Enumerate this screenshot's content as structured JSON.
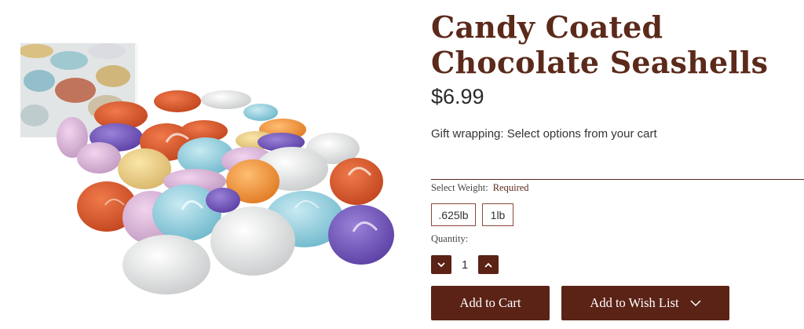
{
  "product": {
    "title": "Candy Coated Chocolate Seashells",
    "price": "$6.99",
    "gift_wrapping": "Gift wrapping: Select options from your cart",
    "image_alt_icon": "product-photo-candy-seashells"
  },
  "weight": {
    "label": "Select Weight:",
    "required": "Required",
    "options": [
      ".625lb",
      "1lb"
    ]
  },
  "quantity": {
    "label": "Quantity:",
    "value": "1"
  },
  "actions": {
    "add_to_cart": "Add to Cart",
    "add_to_wish_list": "Add to Wish List"
  },
  "colors": {
    "brand": "#5b2a1a",
    "button": "#5b2216"
  }
}
